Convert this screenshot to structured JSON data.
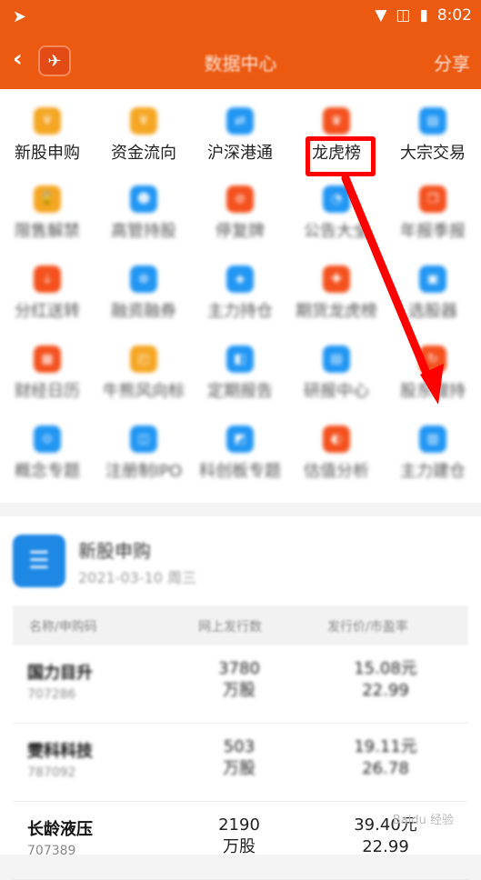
{
  "status_bar": {
    "time": "8:02"
  },
  "header": {
    "title": "数据中心",
    "share_label": "分享"
  },
  "grid": [
    {
      "label": "新股申购",
      "color": "#f5a623"
    },
    {
      "label": "资金流向",
      "color": "#f5a623"
    },
    {
      "label": "沪深港通",
      "color": "#2196f3"
    },
    {
      "label": "龙虎榜",
      "color": "#f4511e"
    },
    {
      "label": "大宗交易",
      "color": "#2196f3"
    },
    {
      "label": "限售解禁",
      "color": "#f5a623"
    },
    {
      "label": "高管持股",
      "color": "#2196f3"
    },
    {
      "label": "停复牌",
      "color": "#f4511e"
    },
    {
      "label": "公告大全",
      "color": "#2196f3"
    },
    {
      "label": "年报季报",
      "color": "#f4511e"
    },
    {
      "label": "分红送转",
      "color": "#f4511e"
    },
    {
      "label": "融资融券",
      "color": "#2196f3"
    },
    {
      "label": "主力持仓",
      "color": "#2196f3"
    },
    {
      "label": "期货龙虎榜",
      "color": "#f4511e"
    },
    {
      "label": "选股器",
      "color": "#2196f3"
    },
    {
      "label": "财经日历",
      "color": "#f4511e"
    },
    {
      "label": "牛熊风向标",
      "color": "#f5a623"
    },
    {
      "label": "定期报告",
      "color": "#2196f3"
    },
    {
      "label": "研报中心",
      "color": "#2196f3"
    },
    {
      "label": "股东增持",
      "color": "#f4511e"
    },
    {
      "label": "概念专题",
      "color": "#2196f3"
    },
    {
      "label": "注册制IPO",
      "color": "#2196f3"
    },
    {
      "label": "科创板专题",
      "color": "#2196f3"
    },
    {
      "label": "估值分析",
      "color": "#f4511e"
    },
    {
      "label": "主力建仓",
      "color": "#2196f3"
    }
  ],
  "card": {
    "title": "新股申购",
    "date": "2021-03-10 周三",
    "columns": [
      "名称/申购码",
      "网上发行数",
      "发行价/市盈率"
    ],
    "rows": [
      {
        "name": "国力目升",
        "code": "707286",
        "issue_num": "3780",
        "issue_unit": "万股",
        "price": "15.08元",
        "pe": "22.99"
      },
      {
        "name": "雯科科技",
        "code": "787092",
        "issue_num": "503",
        "issue_unit": "万股",
        "price": "19.11元",
        "pe": "26.78"
      },
      {
        "name": "长龄液压",
        "code": "707389",
        "issue_num": "2190",
        "issue_unit": "万股",
        "price": "39.40元",
        "pe": "22.99"
      }
    ]
  },
  "watermark": "Baidu 经验"
}
